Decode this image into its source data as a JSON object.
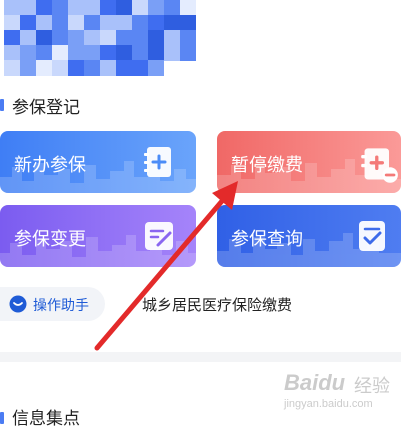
{
  "section": {
    "title": "参保登记"
  },
  "cards": [
    {
      "label": "新办参保",
      "icon": "document-add-icon"
    },
    {
      "label": "暂停缴费",
      "icon": "document-pause-icon"
    },
    {
      "label": "参保变更",
      "icon": "document-edit-icon"
    },
    {
      "label": "参保查询",
      "icon": "document-check-icon"
    }
  ],
  "helper": {
    "label": "操作助手",
    "icon": "chat-bubble-icon"
  },
  "promo": {
    "text": "城乡居民医疗保险缴费"
  },
  "next_section": {
    "title": "信息集点"
  },
  "colors": {
    "blue": "#4b8cf7",
    "red": "#f47a78",
    "purple": "#8a66f0",
    "deep_blue": "#3d6bea",
    "accent_bar": "#4b7cf3",
    "arrow": "#e32a2a"
  },
  "watermark": {
    "brand": "Baidu",
    "cn": "经验",
    "url": "jingyan.baidu.com"
  }
}
